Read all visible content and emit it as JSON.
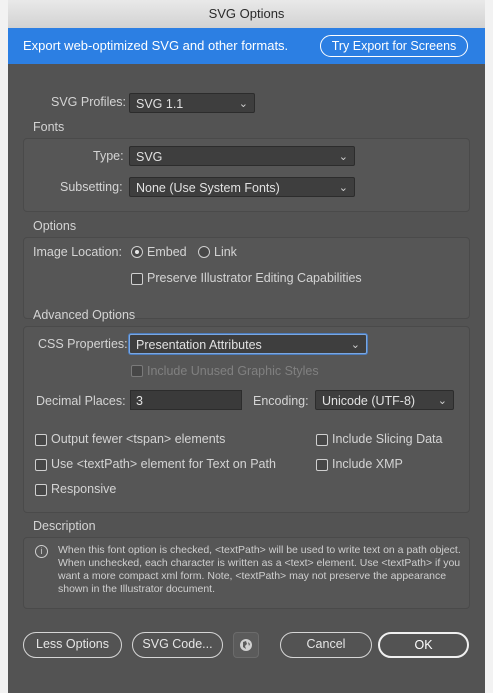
{
  "window": {
    "title": "SVG Options"
  },
  "banner": {
    "text": "Export web-optimized SVG and other formats.",
    "button": "Try Export for Screens"
  },
  "profiles": {
    "label": "SVG Profiles:",
    "value": "SVG 1.1"
  },
  "fonts": {
    "title": "Fonts",
    "type_label": "Type:",
    "type_value": "SVG",
    "subsetting_label": "Subsetting:",
    "subsetting_value": "None (Use System Fonts)"
  },
  "options": {
    "title": "Options",
    "image_location_label": "Image Location:",
    "embed": "Embed",
    "link": "Link",
    "preserve": "Preserve Illustrator Editing Capabilities"
  },
  "advanced": {
    "title": "Advanced Options",
    "css_label": "CSS Properties:",
    "css_value": "Presentation Attributes",
    "unused_styles": "Include Unused Graphic Styles",
    "decimal_label": "Decimal Places:",
    "decimal_value": "3",
    "encoding_label": "Encoding:",
    "encoding_value": "Unicode (UTF-8)",
    "fewer_tspan": "Output fewer <tspan> elements",
    "textpath": "Use <textPath> element for Text on Path",
    "responsive": "Responsive",
    "slicing": "Include Slicing Data",
    "xmp": "Include XMP"
  },
  "description": {
    "title": "Description",
    "text": "When this font option is checked, <textPath> will be used to write text on a path object. When unchecked, each character is written as a <text> element. Use <textPath> if you want a more compact xml form. Note, <textPath> may not preserve the appearance shown in the Illustrator document."
  },
  "buttons": {
    "less": "Less Options",
    "svg_code": "SVG Code...",
    "cancel": "Cancel",
    "ok": "OK"
  },
  "icons": {
    "chevron": "chevron-down-icon",
    "info": "info-icon",
    "globe": "globe-icon"
  }
}
